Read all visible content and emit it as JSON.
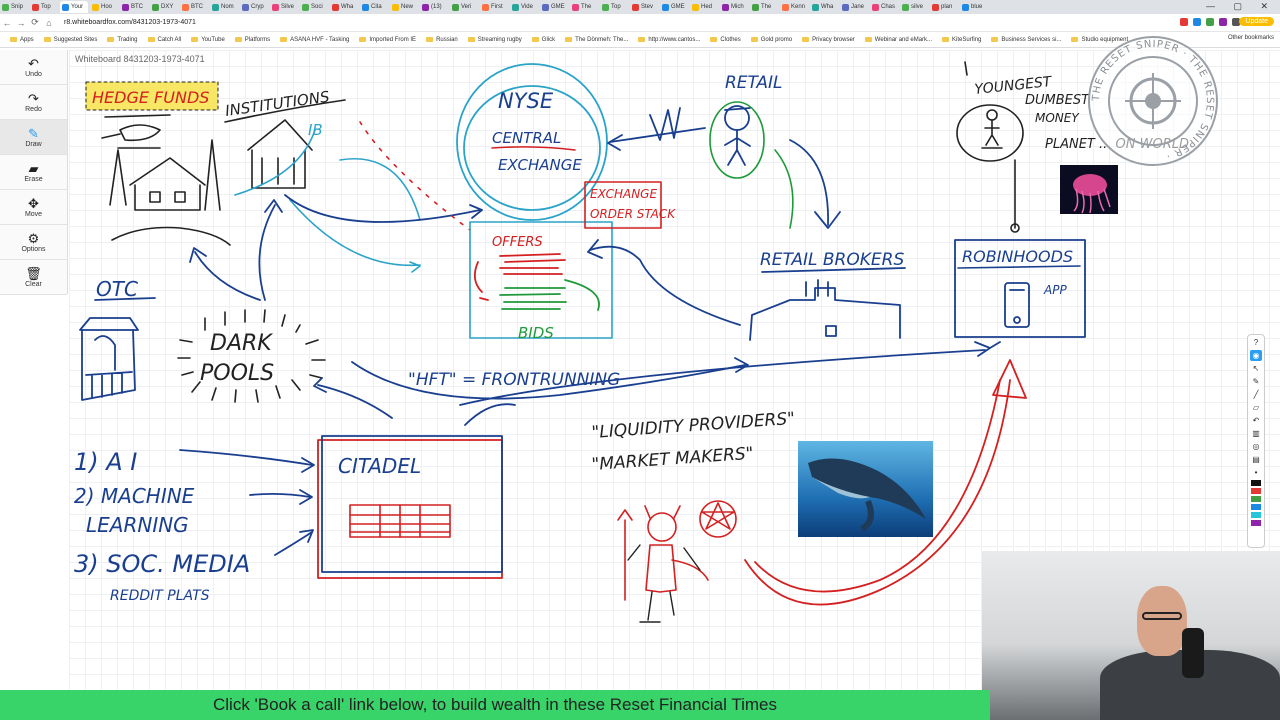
{
  "browser": {
    "tabs": [
      "Snip",
      "Top",
      "Your",
      "Hoo",
      "BTC",
      "DXY",
      "BTC",
      "Nom",
      "Cryp",
      "Silve",
      "Soci",
      "Wha",
      "Cita",
      "New",
      "(13)",
      "Veri",
      "First",
      "Vide",
      "GME",
      "The",
      "Top",
      "Stev",
      "GME",
      "Hed",
      "Mich",
      "The",
      "Kenn",
      "Wha",
      "Jane",
      "Chas",
      "silve",
      "plan",
      "blue"
    ],
    "active_tab_index": 2,
    "url": "r8.whiteboardfox.com/8431203-1973-4071",
    "update_label": "Update",
    "bookmarks": [
      "Apps",
      "Suggested Sites",
      "Trading",
      "Catch All",
      "YouTube",
      "Platforms",
      "ASANA HVF - Tasking",
      "Imported From IE",
      "Russian",
      "Streaming rugby",
      "Glick",
      "The Dönmeh: The...",
      "http://www.cantos...",
      "Clothes",
      "Gold promo",
      "Privacy browser",
      "Webinar and eMark...",
      "KiteSurfing",
      "Business Services si...",
      "Studio equipment"
    ],
    "other_bookmarks": "Other bookmarks"
  },
  "toolbar": {
    "undo": "Undo",
    "redo": "Redo",
    "draw": "Draw",
    "erase": "Erase",
    "move": "Move",
    "options": "Options",
    "clear": "Clear"
  },
  "board": {
    "title": "Whiteboard 8431203-1973-4071",
    "labels": {
      "hedge_funds": "HEDGE FUNDS",
      "institutions": "INSTITUTIONS",
      "ib": "IB",
      "nyse": "NYSE",
      "central": "CENTRAL",
      "exchange": "EXCHANGE",
      "exchange_box_1": "EXCHANGE",
      "exchange_box_2": "ORDER STACK",
      "offers": "OFFERS",
      "bids": "BIDS",
      "retail": "RETAIL",
      "retail_brokers": "RETAIL BROKERS",
      "youngest": "YOUNGEST",
      "dumbest": "DUMBEST",
      "money": "MONEY",
      "planet": "PLANET ... ON WORLD",
      "robinhoods": "ROBINHOODS",
      "app": "APP",
      "otc": "OTC",
      "dark": "DARK",
      "pools": "POOLS",
      "hft": "\"HFT\" = FRONTRUNNING",
      "liquidity": "\"LIQUIDITY PROVIDERS\"",
      "market_makers": "\"MARKET MAKERS\"",
      "citadel": "CITADEL",
      "ai": "1) A I",
      "ml1": "2) MACHINE",
      "ml2": "LEARNING",
      "soc": "3) SOC. MEDIA",
      "reddit": "REDDIT PLATS"
    }
  },
  "logo": {
    "ring_text": "THE RESET SNIPER · THE RESET SNIPER ·"
  },
  "banner": {
    "text": "Click 'Book a call' link below, to build wealth in these Reset Financial Times"
  },
  "colors": {
    "marker_blue": "#1a3f8f",
    "marker_cyan": "#2aa3c9",
    "marker_red": "#d42020",
    "marker_green": "#1f9a3a",
    "marker_black": "#222222",
    "highlight_yellow": "#f7e24a",
    "banner_green": "#38d46a"
  }
}
